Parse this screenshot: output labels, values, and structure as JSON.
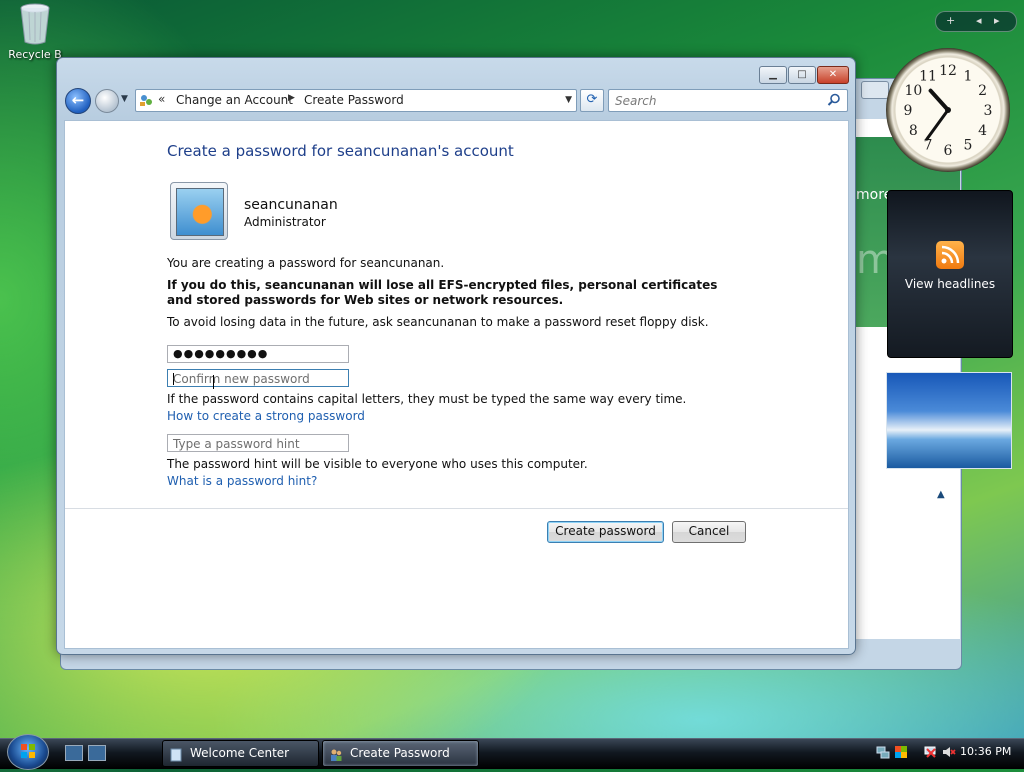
{
  "desktop": {
    "recycle_label": "Recycle B"
  },
  "background_window": {
    "partial_text": "more",
    "partial_letter": "m"
  },
  "window": {
    "address": {
      "chevron": "«",
      "crumb1": "Change an Account",
      "crumb2": "Create Password"
    },
    "search_placeholder": "Search",
    "title": "Create a password for seancunanan's account",
    "user": {
      "name": "seancunanan",
      "role": "Administrator"
    },
    "info1": "You are creating a password for seancunanan.",
    "warning": "If you do this, seancunanan will lose all EFS-encrypted files, personal certificates and stored passwords for Web sites or network resources.",
    "info2": "To avoid losing data in the future, ask seancunanan to make a password reset floppy disk.",
    "password_value": "●●●●●●●●●",
    "confirm_placeholder": "Confirm new password",
    "caps_note": "If the password contains capital letters, they must be typed the same way every time.",
    "strong_link": "How to create a strong password",
    "hint_placeholder": "Type a password hint",
    "hint_note": "The password hint will be visible to everyone who uses this computer.",
    "hint_link": "What is a password hint?",
    "create_button": "Create password",
    "cancel_button": "Cancel"
  },
  "gadgets": {
    "clock_numbers": [
      "12",
      "1",
      "2",
      "3",
      "4",
      "5",
      "6",
      "7",
      "8",
      "9",
      "10",
      "11"
    ],
    "headlines_label": "View headlines",
    "sidebar_plus": "+"
  },
  "taskbar": {
    "tasks": [
      {
        "label": "Welcome Center"
      },
      {
        "label": "Create Password"
      }
    ],
    "time": "10:36 PM"
  }
}
